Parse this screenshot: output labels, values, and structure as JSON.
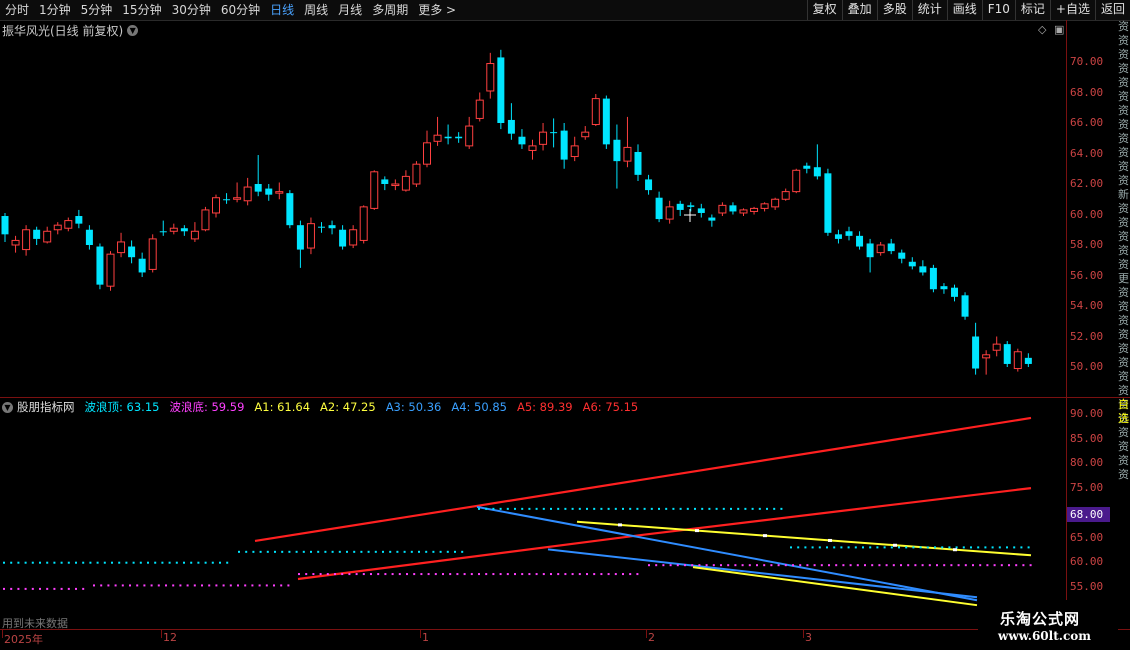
{
  "toolbar": {
    "periods": [
      "分时",
      "1分钟",
      "5分钟",
      "15分钟",
      "30分钟",
      "60分钟",
      "日线",
      "周线",
      "月线",
      "多周期",
      "更多"
    ],
    "active_period": "日线",
    "more_glyph": ">",
    "buttons": [
      "复权",
      "叠加",
      "多股",
      "统计",
      "画线",
      "F10",
      "标记",
      "+自选",
      "返回"
    ]
  },
  "main_chart": {
    "title": "振华风光(日线 前复权)",
    "price_axis": [
      "70.00",
      "68.00",
      "66.00",
      "64.00",
      "62.00",
      "60.00",
      "58.00",
      "56.00",
      "54.00",
      "52.00",
      "50.00"
    ],
    "colors": {
      "up": "#ff4040",
      "down": "#00e5ff"
    }
  },
  "indicator": {
    "name": "股朋指标网",
    "values": [
      {
        "label": "波浪顶:",
        "value": "63.15",
        "color": "#00e5ff"
      },
      {
        "label": "波浪底:",
        "value": "59.59",
        "color": "#ff40ff"
      },
      {
        "label": "A1:",
        "value": "61.64",
        "color": "#ffff40"
      },
      {
        "label": "A2:",
        "value": "47.25",
        "color": "#ffff40"
      },
      {
        "label": "A3:",
        "value": "50.36",
        "color": "#3aa0ff"
      },
      {
        "label": "A4:",
        "value": "50.85",
        "color": "#3aa0ff"
      },
      {
        "label": "A5:",
        "value": "89.39",
        "color": "#ff3030"
      },
      {
        "label": "A6:",
        "value": "75.15",
        "color": "#ff3030"
      }
    ],
    "axis": [
      "90.00",
      "85.00",
      "80.00",
      "75.00",
      "70.00",
      "65.00",
      "60.00",
      "55.00"
    ],
    "current_value": "68.00",
    "future_note": "用到未来数据"
  },
  "date_axis": [
    {
      "label": "2025年"
    },
    {
      "label": "12"
    },
    {
      "label": "1"
    },
    {
      "label": "2"
    },
    {
      "label": "3"
    }
  ],
  "watermark": {
    "line1": "乐淘公式网",
    "line2": "www.60lt.com"
  },
  "right_strip": {
    "top": "资资资资资资资资资资资资新资资资资资更资资资资资资资资资资资资资资",
    "bottom": "自选"
  }
}
